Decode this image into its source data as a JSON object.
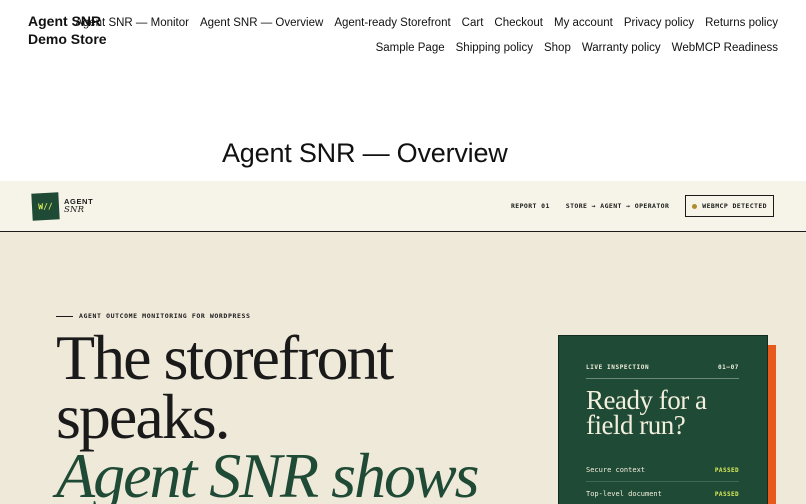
{
  "site": {
    "title": "Agent SNR Demo Store",
    "nav": {
      "row1": [
        "Agent SNR — Monitor",
        "Agent SNR — Overview",
        "Agent-ready Storefront",
        "Cart",
        "Checkout",
        "My account",
        "Privacy policy",
        "Returns policy"
      ],
      "row2": [
        "Sample Page",
        "Shipping policy",
        "Shop",
        "Warranty policy",
        "WebMCP Readiness"
      ]
    }
  },
  "page": {
    "title": "Agent SNR — Overview"
  },
  "app_bar": {
    "logo_mark": "W//",
    "logo_line1": "AGENT",
    "logo_line2": "SNR",
    "report": "REPORT 01",
    "flow": "STORE → AGENT → OPERATOR",
    "badge": "WEBMCP DETECTED"
  },
  "hero": {
    "eyebrow": "AGENT OUTCOME MONITORING FOR WORDPRESS",
    "headline_line1": "The storefront",
    "headline_line2": "speaks.",
    "headline_line3": "Agent SNR shows"
  },
  "card": {
    "label": "LIVE INSPECTION",
    "counter": "01—07",
    "title_line1": "Ready for a",
    "title_line2": "field run?",
    "checks": [
      {
        "name": "Secure context",
        "status": "PASSED"
      },
      {
        "name": "Top-level document",
        "status": "PASSED"
      }
    ]
  },
  "colors": {
    "accent_green": "#1f4a35",
    "accent_lime": "#d9ec5a",
    "accent_orange": "#e85a1c",
    "hero_bg": "#efe9da"
  }
}
